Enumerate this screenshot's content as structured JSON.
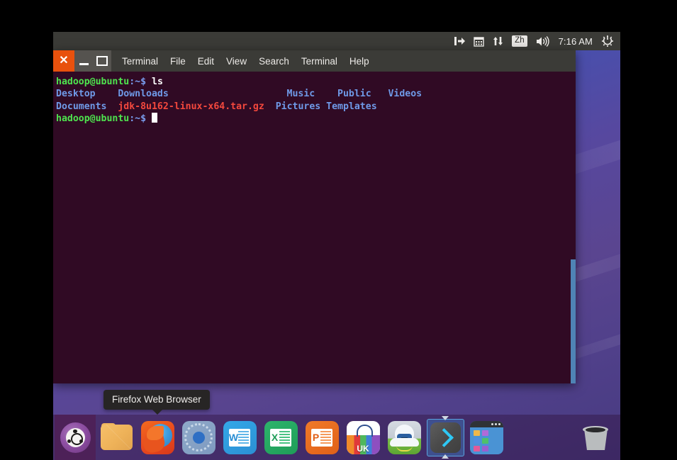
{
  "desktop": {
    "wallpaper_colors": [
      "#2a62c4",
      "#57489f",
      "#473a80"
    ]
  },
  "top_panel": {
    "background": "#3b3b37",
    "tray": [
      {
        "name": "keyboard-layout-icon",
        "glyph": "❙➡"
      },
      {
        "name": "calendar-icon",
        "glyph": "▦"
      },
      {
        "name": "network-icon",
        "glyph": "↑↓"
      },
      {
        "name": "input-method-icon",
        "glyph": "Zh"
      },
      {
        "name": "volume-icon",
        "glyph": "🔊"
      }
    ],
    "clock": "7:16 AM",
    "session_menu": "⚙"
  },
  "terminal": {
    "window_title": "Terminal",
    "titlebar_background": "#3b3b37",
    "close_button_color": "#e8510d",
    "buttons": {
      "close": "✕",
      "minimize": "—",
      "maximize": "▢"
    },
    "menu": [
      {
        "label": "Terminal",
        "is_title": true
      },
      {
        "label": "File",
        "is_title": false
      },
      {
        "label": "Edit",
        "is_title": false
      },
      {
        "label": "View",
        "is_title": false
      },
      {
        "label": "Search",
        "is_title": false
      },
      {
        "label": "Terminal",
        "is_title": false
      },
      {
        "label": "Help",
        "is_title": false
      }
    ],
    "background": "#300a24",
    "scrollbar_color": "#4f83b5",
    "prompt_user_host": "hadoop@ubuntu",
    "prompt_path": ":~$",
    "command": "ls",
    "output_rows": [
      [
        "Desktop",
        "Downloads",
        "Music",
        "Public",
        "Videos"
      ],
      [
        "Documents",
        "jdk-8u162-linux-x64.tar.gz",
        "Pictures",
        "Templates",
        ""
      ]
    ],
    "archive_file": "jdk-8u162-linux-x64.tar.gz",
    "colors": {
      "prompt": "#4ee44e",
      "path": "#7a9ef0",
      "directory": "#6f9ae8",
      "archive": "#f4483d",
      "command": "#ffffff"
    }
  },
  "tooltip": {
    "text": "Firefox Web Browser"
  },
  "dock": {
    "background": "rgba(48,17,60,0.42)",
    "items": [
      {
        "name": "ubuntu-dash-icon",
        "label": "Ubuntu Dash",
        "selected": false
      },
      {
        "name": "files-icon",
        "label": "Files",
        "selected": false
      },
      {
        "name": "firefox-icon",
        "label": "Firefox Web Browser",
        "selected": false
      },
      {
        "name": "chromium-icon",
        "label": "Chromium Web Browser",
        "selected": false
      },
      {
        "name": "word-icon",
        "label": "Word",
        "letter": "W",
        "selected": false
      },
      {
        "name": "excel-icon",
        "label": "Excel",
        "letter": "X",
        "selected": false
      },
      {
        "name": "powerpoint-icon",
        "label": "PowerPoint",
        "letter": "P",
        "selected": false
      },
      {
        "name": "ubuntu-software-icon",
        "label": "Ubuntu Software",
        "badge": "UK",
        "selected": false
      },
      {
        "name": "help-icon",
        "label": "Help",
        "selected": false
      },
      {
        "name": "terminal-icon",
        "label": "Terminal",
        "selected": true
      },
      {
        "name": "workspace-switcher-icon",
        "label": "Workspace Switcher",
        "selected": false
      },
      {
        "name": "trash-icon",
        "label": "Trash",
        "selected": false
      }
    ]
  }
}
